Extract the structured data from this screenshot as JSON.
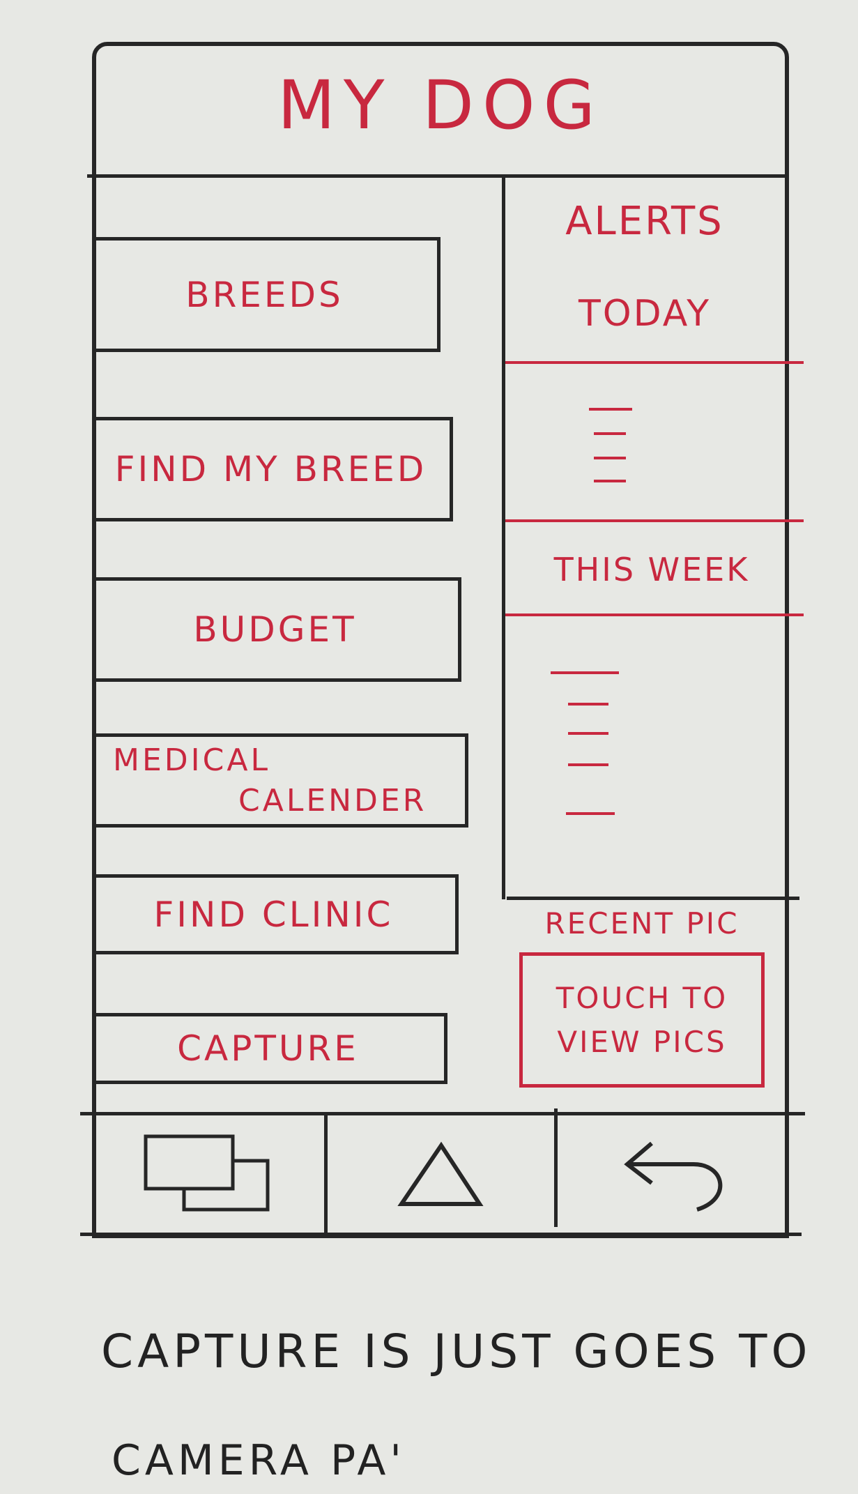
{
  "header": {
    "title": "MY DOG"
  },
  "menu": {
    "breeds": "BREEDS",
    "find_my_breed": "FIND MY BREED",
    "budget": "BUDGET",
    "medical_line1": "MEDICAL",
    "medical_line2": "CALENDER",
    "find_clinic": "FIND CLINIC",
    "capture": "CAPTURE"
  },
  "alerts": {
    "heading_line1": "ALERTS",
    "heading_line2": "TODAY",
    "this_week": "THIS WEEK"
  },
  "recent_pic": {
    "label": "RECENT PIC",
    "line1": "TOUCH TO",
    "line2": "VIEW PICS"
  },
  "nav": {
    "recent_apps_icon": "recent-apps-icon",
    "home_icon": "home-triangle-icon",
    "back_icon": "back-arrow-icon"
  },
  "note": {
    "line1": "CAPTURE IS JUST GOES TO",
    "line2": "CAMERA PA'"
  },
  "colors": {
    "ink": "#262626",
    "marker": "#c8283f",
    "paper": "#e7e8e4"
  }
}
